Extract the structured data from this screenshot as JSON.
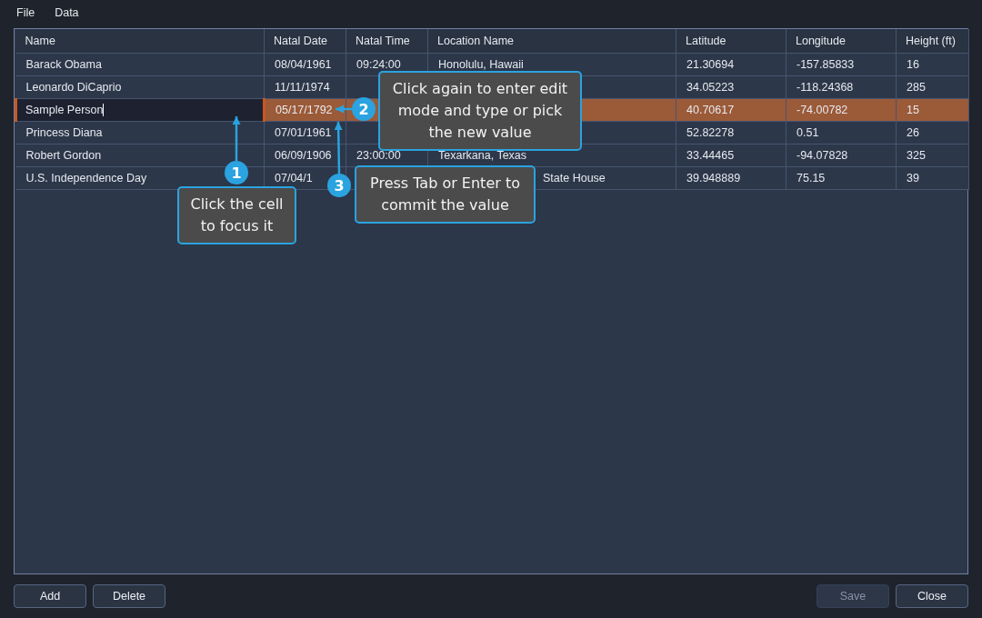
{
  "menu": [
    "File",
    "Data"
  ],
  "table": {
    "columns": [
      "Name",
      "Natal Date",
      "Natal Time",
      "Location Name",
      "Latitude",
      "Longitude",
      "Height (ft)"
    ],
    "rows": [
      {
        "selected": false,
        "editing": false,
        "cells": [
          "Barack Obama",
          "08/04/1961",
          "09:24:00",
          "Honolulu, Hawaii",
          "21.30694",
          "-157.85833",
          "16"
        ]
      },
      {
        "selected": false,
        "editing": false,
        "cells": [
          "Leonardo DiCaprio",
          "11/11/1974",
          null,
          null,
          "34.05223",
          "-118.24368",
          "285"
        ]
      },
      {
        "selected": true,
        "editing": true,
        "cells": [
          "Sample Person",
          "05/17/1792",
          null,
          null,
          "40.70617",
          "-74.00782",
          "15"
        ]
      },
      {
        "selected": false,
        "editing": false,
        "cells": [
          "Princess Diana",
          "07/01/1961",
          null,
          null,
          "52.82278",
          "0.51",
          "26"
        ]
      },
      {
        "selected": false,
        "editing": false,
        "cells": [
          "Robert Gordon",
          "06/09/1906",
          "23:00:00",
          "Texarkana, Texas",
          "33.44465",
          "-94.07828",
          "325"
        ]
      },
      {
        "selected": false,
        "editing": false,
        "cells": [
          "U.S. Independence Day",
          "07/04/1",
          null,
          "State House",
          "39.948889",
          "75.15",
          "39"
        ]
      }
    ]
  },
  "callouts": [
    {
      "number": "1",
      "text": "Click the cell to focus it"
    },
    {
      "number": "2",
      "text": "Click again to enter edit mode and type or pick the new value"
    },
    {
      "number": "3",
      "text": "Press Tab or Enter to commit the value"
    }
  ],
  "buttons_left": [
    {
      "label": "Add",
      "disabled": false
    },
    {
      "label": "Delete",
      "disabled": false
    }
  ],
  "buttons_right": [
    {
      "label": "Save",
      "disabled": true
    },
    {
      "label": "Close",
      "disabled": false
    }
  ]
}
